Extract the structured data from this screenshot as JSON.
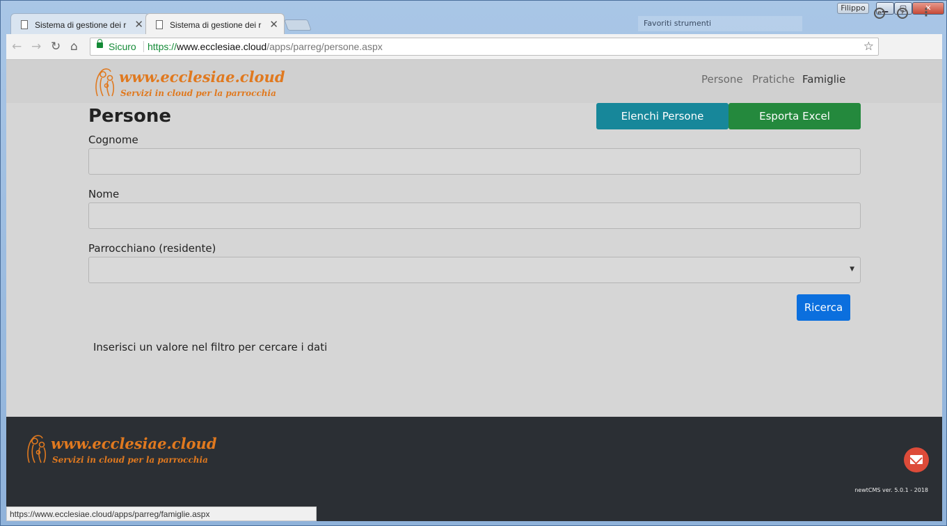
{
  "window": {
    "user_badge": "Filippo",
    "preferiti": "Favoriti strumenti",
    "controls": {
      "minimize": "▁",
      "maximize": "▢",
      "close": "✕"
    }
  },
  "tabs": [
    {
      "label": "Sistema di gestione dei r",
      "close": "✕"
    },
    {
      "label": "Sistema di gestione dei r",
      "close": "✕"
    }
  ],
  "toolbar": {
    "back": "←",
    "forward": "→",
    "reload": "↻",
    "home": "⌂",
    "secure_label": "Sicuro",
    "url_scheme": "https://",
    "url_host": "www.ecclesiae.cloud",
    "url_path": "/apps/parreg/persone.aspx",
    "star": "☆",
    "ext1": "e",
    "ext2": "?",
    "menu": "⋮"
  },
  "site": {
    "logo_line1": "www.ecclesiae.cloud",
    "logo_line2": "Servizi in cloud per la parrocchia",
    "nav": [
      "Persone",
      "Pratiche",
      "Famiglie"
    ]
  },
  "page": {
    "title": "Persone",
    "btn_elenchi": "Elenchi Persone",
    "btn_excel": "Esporta Excel",
    "label_cognome": "Cognome",
    "label_nome": "Nome",
    "label_parrocchiano": "Parrocchiano (residente)",
    "select_caret": "▼",
    "btn_ricerca": "Ricerca",
    "hint": "Inserisci un valore nel filtro per cercare i dati"
  },
  "footer": {
    "logo_line1": "www.ecclesiae.cloud",
    "logo_line2": "Servizi in cloud per la parrocchia",
    "version": "newtCMS ver. 5.0.1 - 2018"
  },
  "statusbar": {
    "link": "https://www.ecclesiae.cloud/apps/parreg/famiglie.aspx"
  },
  "colors": {
    "brand_orange": "#e0791f",
    "elenchi_teal": "#17879a",
    "excel_green": "#24893d",
    "ricerca_blue": "#0b6fde",
    "footer_dark": "#2b2f34",
    "mail_red": "#dd4b39"
  }
}
